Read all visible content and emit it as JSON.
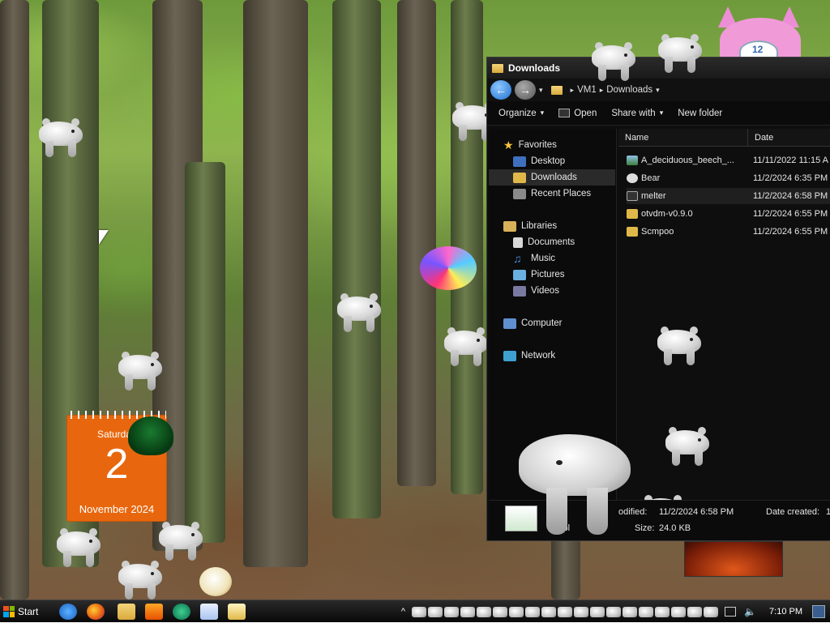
{
  "calendar": {
    "day": "Saturday",
    "date": "2",
    "month_year": "November 2024"
  },
  "alarm_clock": {
    "number": "12"
  },
  "window": {
    "title": "Downloads",
    "breadcrumb": [
      "VM1",
      "Downloads"
    ],
    "toolbar": {
      "organize": "Organize",
      "open": "Open",
      "share": "Share with",
      "new_folder": "New folder"
    },
    "nav": {
      "favorites": "Favorites",
      "desktop": "Desktop",
      "downloads": "Downloads",
      "recent": "Recent Places",
      "libraries": "Libraries",
      "documents": "Documents",
      "music": "Music",
      "pictures": "Pictures",
      "videos": "Videos",
      "computer": "Computer",
      "network": "Network"
    },
    "columns": {
      "name": "Name",
      "date": "Date"
    },
    "files": [
      {
        "name": "A_deciduous_beech_...",
        "date": "11/11/2022 11:15 A",
        "icon": "image"
      },
      {
        "name": "Bear",
        "date": "11/2/2024 6:35 PM",
        "icon": "bear"
      },
      {
        "name": "melter",
        "date": "11/2/2024 6:58 PM",
        "icon": "app"
      },
      {
        "name": "otvdm-v0.9.0",
        "date": "11/2/2024 6:55 PM",
        "icon": "folder"
      },
      {
        "name": "Scmpoo",
        "date": "11/2/2024 6:55 PM",
        "icon": "folder"
      }
    ],
    "details": {
      "type_fragment": "Appl",
      "modified_label": "odified:",
      "modified": "11/2/2024 6:58 PM",
      "size_label": "Size:",
      "size": "24.0 KB",
      "created_label": "Date created:",
      "created": "1"
    }
  },
  "taskbar": {
    "start": "Start",
    "clock": "7:10 PM",
    "tray_expander": "^"
  },
  "colors": {
    "calendar": "#e8670e",
    "explorer_bg": "#0e0e0e",
    "taskbar": "#101010"
  }
}
